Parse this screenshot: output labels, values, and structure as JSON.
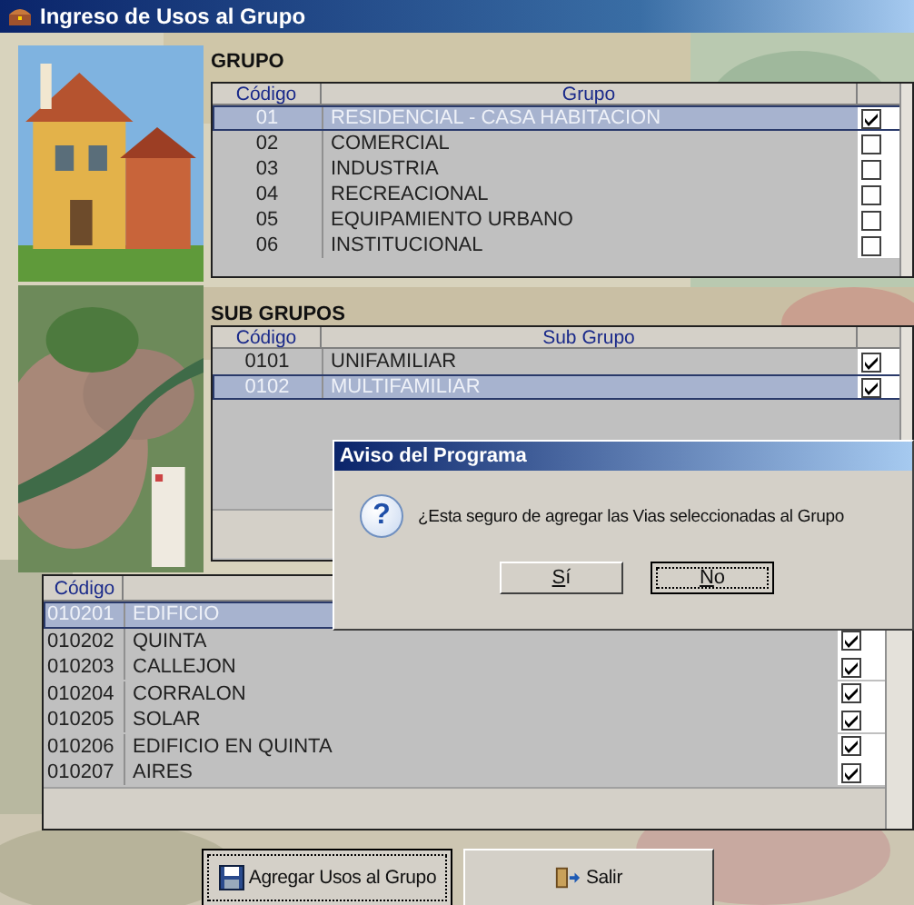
{
  "window": {
    "title": "Ingreso de Usos al Grupo"
  },
  "grupo": {
    "label": "GRUPO",
    "columns": [
      "Código",
      "Grupo"
    ],
    "rows": [
      {
        "code": "01",
        "name": "RESIDENCIAL - CASA HABITACION",
        "checked": true,
        "selected": true
      },
      {
        "code": "02",
        "name": "COMERCIAL",
        "checked": false,
        "selected": false
      },
      {
        "code": "03",
        "name": "INDUSTRIA",
        "checked": false,
        "selected": false
      },
      {
        "code": "04",
        "name": "RECREACIONAL",
        "checked": false,
        "selected": false
      },
      {
        "code": "05",
        "name": "EQUIPAMIENTO URBANO",
        "checked": false,
        "selected": false
      },
      {
        "code": "06",
        "name": "INSTITUCIONAL",
        "checked": false,
        "selected": false
      }
    ]
  },
  "sub_grupos": {
    "label": "SUB GRUPOS",
    "columns": [
      "Código",
      "Sub Grupo"
    ],
    "rows": [
      {
        "code": "0101",
        "name": "UNIFAMILIAR",
        "checked": true,
        "selected": false
      },
      {
        "code": "0102",
        "name": "MULTIFAMILIAR",
        "checked": true,
        "selected": true
      }
    ]
  },
  "usos": {
    "columns": [
      "Código"
    ],
    "rows": [
      {
        "code": "010201",
        "name": "EDIFICIO",
        "selected": true
      },
      {
        "code": "010202",
        "name": "QUINTA",
        "checked": true,
        "selected": false
      },
      {
        "code": "010203",
        "name": "CALLEJON",
        "checked": true,
        "selected": false
      },
      {
        "code": "010204",
        "name": "CORRALON",
        "checked": true,
        "selected": false
      },
      {
        "code": "010205",
        "name": "SOLAR",
        "checked": true,
        "selected": false
      },
      {
        "code": "010206",
        "name": "EDIFICIO EN QUINTA",
        "checked": true,
        "selected": false
      },
      {
        "code": "010207",
        "name": "AIRES",
        "checked": true,
        "selected": false
      }
    ]
  },
  "buttons": [
    {
      "label": "Agregar Usos al Grupo",
      "kind": "save",
      "focused": true
    },
    {
      "label": "Salir",
      "kind": "exit",
      "focused": false
    }
  ],
  "dialog": {
    "title": "Aviso del Programa",
    "icon": "?",
    "message": "¿Esta seguro de agregar las Vias seleccionadas al Grupo",
    "buttons": [
      {
        "label": "Sí",
        "focused": false
      },
      {
        "label": "No",
        "focused": true
      }
    ]
  }
}
